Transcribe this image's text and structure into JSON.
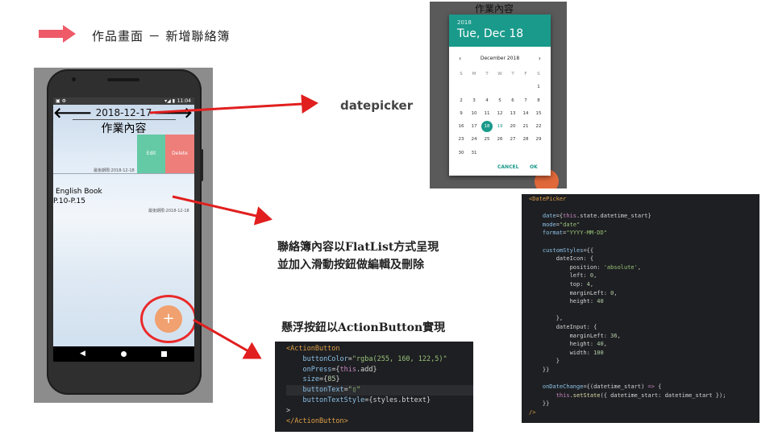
{
  "header": {
    "title": "作品畫面 － 新增聯絡簿"
  },
  "phone": {
    "status_time": "11:04",
    "status_left": "▣ ⚙",
    "status_icons": "▾◢ ▮",
    "date": "2018-12-17",
    "heading": "作業內容",
    "edit_label": "Edit",
    "delete_label": "Delete",
    "card1_meta": "最後期限:2018-12-18",
    "item_title": "English Book",
    "item_sub": "P.10-P.15",
    "item_meta": "最後期限:2018-12-18",
    "fab_label": "+",
    "nav_left_arrow": "🡐",
    "nav_right_arrow": "🡒"
  },
  "labels": {
    "datepicker": "datepicker",
    "flatlist_line1": "聯絡簿內容以FlatList方式呈現",
    "flatlist_line2": "並加入滑動按鈕做編輯及刪除",
    "actionbutton": "懸浮按鈕以ActionButton實現"
  },
  "datepicker_shot": {
    "bg_title": "作業內容",
    "year": "2018",
    "date": "Tue, Dec 18",
    "month": "December 2018",
    "prev": "‹",
    "next": "›",
    "weekdays": [
      "S",
      "M",
      "T",
      "W",
      "T",
      "F",
      "S"
    ],
    "weeks": [
      [
        "",
        "",
        "",
        "",
        "",
        "",
        "1"
      ],
      [
        "2",
        "3",
        "4",
        "5",
        "6",
        "7",
        "8"
      ],
      [
        "9",
        "10",
        "11",
        "12",
        "13",
        "14",
        "15"
      ],
      [
        "16",
        "17",
        "18",
        "19",
        "20",
        "21",
        "22"
      ],
      [
        "23",
        "24",
        "25",
        "26",
        "27",
        "28",
        "29"
      ],
      [
        "30",
        "31",
        "",
        "",
        "",
        "",
        ""
      ]
    ],
    "selected_day": "18",
    "highlighted_day": "19",
    "cancel": "CANCEL",
    "ok": "OK",
    "accent": "#1a9a8b"
  },
  "code_datepicker": [
    [
      [
        "t-tag",
        "<DatePicker"
      ]
    ],
    [
      [
        "t-pun",
        ""
      ]
    ],
    [
      [
        "t-pun",
        "    "
      ],
      [
        "t-attr",
        "date"
      ],
      [
        "t-pun",
        "={"
      ],
      [
        "t-kw",
        "this"
      ],
      [
        "t-pun",
        ".state.datetime_start}"
      ]
    ],
    [
      [
        "t-pun",
        "    "
      ],
      [
        "t-attr",
        "mode"
      ],
      [
        "t-pun",
        "="
      ],
      [
        "t-str",
        "\"date\""
      ]
    ],
    [
      [
        "t-pun",
        "    "
      ],
      [
        "t-attr",
        "format"
      ],
      [
        "t-pun",
        "="
      ],
      [
        "t-str",
        "\"YYYY-MM-DD\""
      ]
    ],
    [
      [
        "t-pun",
        ""
      ]
    ],
    [
      [
        "t-pun",
        "    "
      ],
      [
        "t-attr",
        "customStyles"
      ],
      [
        "t-pun",
        "={{"
      ]
    ],
    [
      [
        "t-pun",
        "        dateIcon: {"
      ]
    ],
    [
      [
        "t-pun",
        "            position: "
      ],
      [
        "t-str",
        "'absolute'"
      ],
      [
        "t-pun",
        ","
      ]
    ],
    [
      [
        "t-pun",
        "            left: "
      ],
      [
        "t-num",
        "0"
      ],
      [
        "t-pun",
        ","
      ]
    ],
    [
      [
        "t-pun",
        "            top: "
      ],
      [
        "t-num",
        "4"
      ],
      [
        "t-pun",
        ","
      ]
    ],
    [
      [
        "t-pun",
        "            marginLeft: "
      ],
      [
        "t-num",
        "0"
      ],
      [
        "t-pun",
        ","
      ]
    ],
    [
      [
        "t-pun",
        "            height: "
      ],
      [
        "t-num",
        "40"
      ]
    ],
    [
      [
        "t-pun",
        ""
      ]
    ],
    [
      [
        "t-pun",
        "        },"
      ]
    ],
    [
      [
        "t-pun",
        "        dateInput: {"
      ]
    ],
    [
      [
        "t-pun",
        "            marginLeft: "
      ],
      [
        "t-num",
        "36"
      ],
      [
        "t-pun",
        ","
      ]
    ],
    [
      [
        "t-pun",
        "            height: "
      ],
      [
        "t-num",
        "40"
      ],
      [
        "t-pun",
        ","
      ]
    ],
    [
      [
        "t-pun",
        "            width: "
      ],
      [
        "t-num",
        "100"
      ]
    ],
    [
      [
        "t-pun",
        "        }"
      ]
    ],
    [
      [
        "t-pun",
        "    }}"
      ]
    ],
    [
      [
        "t-pun",
        ""
      ]
    ],
    [
      [
        "t-pun",
        "    "
      ],
      [
        "t-attr",
        "onDateChange"
      ],
      [
        "t-pun",
        "={(datetime_start) "
      ],
      [
        "t-kw",
        "=>"
      ],
      [
        "t-pun",
        " {"
      ]
    ],
    [
      [
        "t-pun",
        "        "
      ],
      [
        "t-kw",
        "this"
      ],
      [
        "t-pun",
        "."
      ],
      [
        "t-fn",
        "setState"
      ],
      [
        "t-pun",
        "({ datetime_start: datetime_start });"
      ]
    ],
    [
      [
        "t-pun",
        "    }}"
      ]
    ],
    [
      [
        "t-tag",
        "/>"
      ]
    ]
  ],
  "code_actionbutton": [
    [
      [
        "t-tag",
        "<ActionButton"
      ]
    ],
    [
      [
        "t-pun",
        "    "
      ],
      [
        "t-attr",
        "buttonColor"
      ],
      [
        "t-pun",
        "="
      ],
      [
        "t-str",
        "\"rgba(255, 160, 122,5)\""
      ]
    ],
    [
      [
        "t-pun",
        "    "
      ],
      [
        "t-attr",
        "onPress"
      ],
      [
        "t-pun",
        "={"
      ],
      [
        "t-kw",
        "this"
      ],
      [
        "t-pun",
        ".add}"
      ]
    ],
    [
      [
        "t-pun",
        "    "
      ],
      [
        "t-attr",
        "size"
      ],
      [
        "t-pun",
        "={"
      ],
      [
        "t-num",
        "85"
      ],
      [
        "t-pun",
        "}"
      ]
    ],
    [
      [
        "t-pun",
        "    "
      ],
      [
        "t-attr",
        "buttonText"
      ],
      [
        "t-pun",
        "="
      ],
      [
        "t-str",
        "\"▯\""
      ]
    ],
    [
      [
        "t-pun",
        "    "
      ],
      [
        "t-attr",
        "buttonTextStyle"
      ],
      [
        "t-pun",
        "={styles.bttext}"
      ]
    ],
    [
      [
        "t-pun",
        ">"
      ]
    ],
    [
      [
        "t-tag",
        "</ActionButton>"
      ]
    ]
  ],
  "code_actionbutton_highlight_line": 4
}
